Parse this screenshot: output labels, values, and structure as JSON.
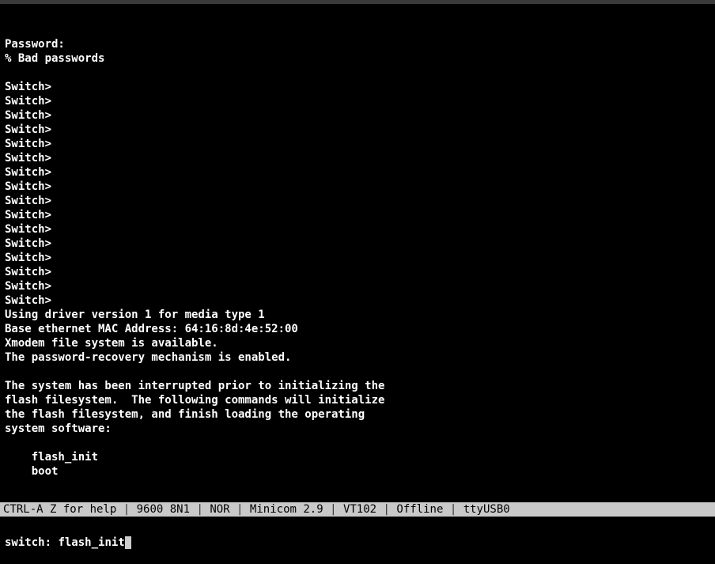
{
  "terminal": {
    "lines": [
      "Password:",
      "% Bad passwords",
      "",
      "Switch>",
      "Switch>",
      "Switch>",
      "Switch>",
      "Switch>",
      "Switch>",
      "Switch>",
      "Switch>",
      "Switch>",
      "Switch>",
      "Switch>",
      "Switch>",
      "Switch>",
      "Switch>",
      "Switch>",
      "Switch>",
      "Using driver version 1 for media type 1",
      "Base ethernet MAC Address: 64:16:8d:4e:52:00",
      "Xmodem file system is available.",
      "The password-recovery mechanism is enabled.",
      "",
      "The system has been interrupted prior to initializing the",
      "flash filesystem.  The following commands will initialize",
      "the flash filesystem, and finish loading the operating",
      "system software:",
      "",
      "    flash_init",
      "    boot",
      "",
      ""
    ],
    "prompt": "switch: ",
    "input": "flash_init"
  },
  "status": {
    "help": "CTRL-A Z for help",
    "baud": "9600 8N1",
    "flow": "NOR",
    "app": "Minicom 2.9",
    "term": "VT102",
    "conn": "Offline",
    "port": "ttyUSB0",
    "sep": " | "
  }
}
